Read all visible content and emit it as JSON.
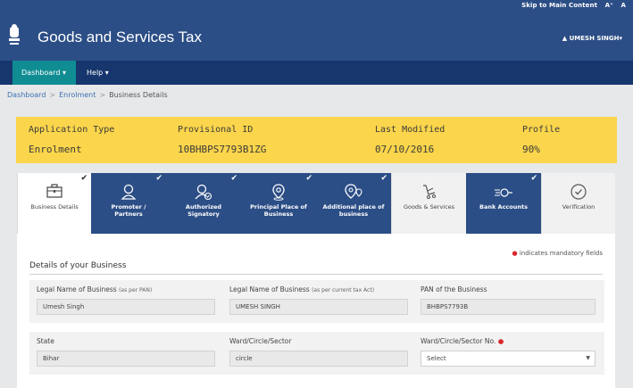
{
  "top_links": {
    "skip": "Skip to Main Content",
    "font_large": "A⁺",
    "font_normal": "A"
  },
  "header": {
    "title": "Goods and Services Tax",
    "user": "UMESH SINGH"
  },
  "nav": {
    "dashboard": "Dashboard",
    "help": "Help"
  },
  "breadcrumb": {
    "dashboard": "Dashboard",
    "enrolment": "Enrolment",
    "current": "Business Details"
  },
  "application": {
    "type_label": "Application Type",
    "type_value": "Enrolment",
    "pid_label": "Provisional ID",
    "pid_value": "10BHBPS7793B1ZG",
    "modified_label": "Last Modified",
    "modified_value": "07/10/2016",
    "profile_label": "Profile",
    "profile_value": "90%"
  },
  "tabs": [
    {
      "l1": "Business Details",
      "l2": "",
      "icon": "briefcase-icon"
    },
    {
      "l1": "Promoter /",
      "l2": "Partners",
      "icon": "user-icon"
    },
    {
      "l1": "Authorized",
      "l2": "Signatory",
      "icon": "user-check-icon"
    },
    {
      "l1": "Principal Place of",
      "l2": "Business",
      "icon": "location-pin-icon"
    },
    {
      "l1": "Additional place of",
      "l2": "business",
      "icon": "locations-icon"
    },
    {
      "l1": "Goods & Services",
      "l2": "",
      "icon": "cart-icon"
    },
    {
      "l1": "Bank Accounts",
      "l2": "",
      "icon": "bank-icon"
    },
    {
      "l1": "Verification",
      "l2": "",
      "icon": "check-circle-icon"
    }
  ],
  "form": {
    "mandatory_note": "indicates mandatory fields",
    "section_title": "Details of your Business",
    "legal_name_label": "Legal Name of Business",
    "legal_name_hint": "(as per PAN)",
    "legal_name_value": "Umesh Singh",
    "legal_tax_label": "Legal Name of Business",
    "legal_tax_hint": "(as per current tax Act)",
    "legal_tax_value": "UMESH SINGH",
    "pan_label": "PAN of the Business",
    "pan_value": "BHBPS7793B",
    "state_label": "State",
    "state_value": "Bihar",
    "ward_label": "Ward/Circle/Sector",
    "ward_value": "circle",
    "ward_no_label": "Ward/Circle/Sector No.",
    "ward_no_value": "Select"
  }
}
